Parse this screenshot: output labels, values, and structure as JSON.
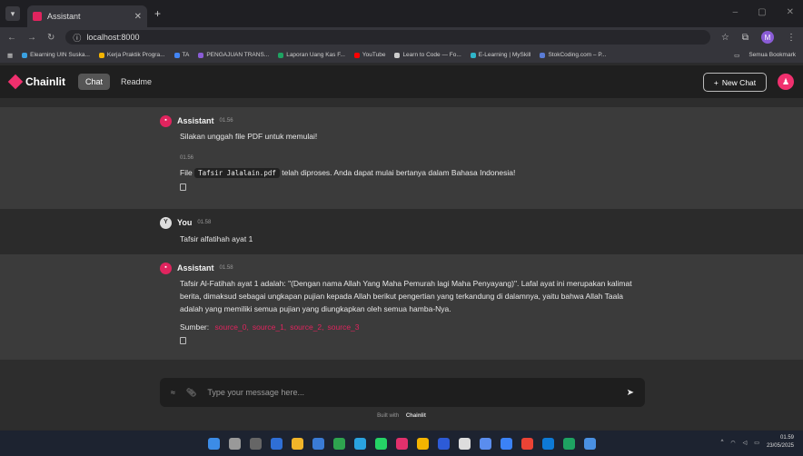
{
  "browser": {
    "tab_title": "Assistant",
    "url": "localhost:8000",
    "profile_initial": "M",
    "bookmarks": [
      {
        "label": "Elearning UIN Suska...",
        "color": "#3aa0e0"
      },
      {
        "label": "Kerja Praktik Progra...",
        "color": "#f5b400"
      },
      {
        "label": "TA",
        "color": "#4285f4"
      },
      {
        "label": "PENGAJUAN TRANS...",
        "color": "#8a5cd6"
      },
      {
        "label": "Laporan Uang Kas F...",
        "color": "#1ea362"
      },
      {
        "label": "YouTube",
        "color": "#ff0000"
      },
      {
        "label": "Learn to Code — Fo...",
        "color": "#cccccc"
      },
      {
        "label": "E-Learning | MySkill",
        "color": "#2fb5c9"
      },
      {
        "label": "StokCoding.com – P...",
        "color": "#5a7cd6"
      }
    ],
    "all_bookmarks": "Semua Bookmark"
  },
  "app": {
    "brand": "Chainlit",
    "tabs": [
      "Chat",
      "Readme"
    ],
    "new_chat": "New Chat"
  },
  "messages": [
    {
      "author": "Assistant",
      "time": "01.56",
      "text": "Silakan unggah file PDF untuk memulai!",
      "time2": "01.56",
      "text2_before": "File",
      "text2_code": "Tafsir Jalalain.pdf",
      "text2_after": "telah diproses. Anda dapat mulai bertanya dalam Bahasa Indonesia!"
    },
    {
      "author": "You",
      "avatar": "Y",
      "time": "01.58",
      "text": "Tafsir alfatihah ayat 1"
    },
    {
      "author": "Assistant",
      "time": "01.58",
      "text": "Tafsir Al-Fatihah ayat 1 adalah: \"(Dengan nama Allah Yang Maha Pemurah lagi Maha Penyayang)\". Lafal ayat ini merupakan kalimat berita, dimaksud sebagai ungkapan pujian kepada Allah berikut pengertian yang terkandung di dalamnya, yaitu bahwa Allah Taala adalah yang memiliki semua pujian yang diungkapkan oleh semua hamba-Nya.",
      "sources_label": "Sumber:",
      "sources": [
        "source_0,",
        "source_1,",
        "source_2,",
        "source_3"
      ]
    }
  ],
  "input": {
    "placeholder": "Type your message here..."
  },
  "footer": {
    "built_with": "Built with",
    "brand": "Chainlit"
  },
  "taskbar": {
    "time": "01.59",
    "date": "23/05/2025"
  }
}
